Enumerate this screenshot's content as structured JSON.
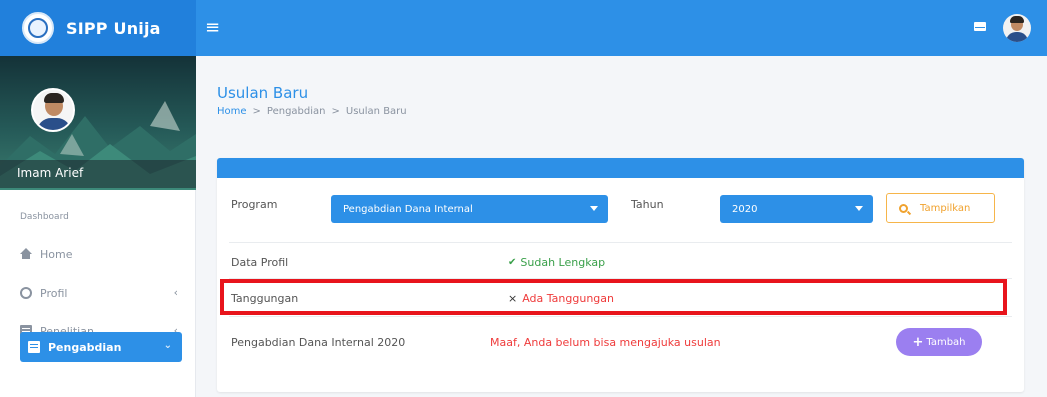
{
  "app": {
    "title": "SIPP Unija"
  },
  "topbar": {
    "menu_icon": "hamburger-icon",
    "mail_icon": "mail-icon",
    "avatar": "user-avatar"
  },
  "sidebar": {
    "user_name": "Imam Arief",
    "section_label": "Dashboard",
    "items": [
      {
        "label": "Home",
        "icon": "home-icon",
        "has_chevron": false,
        "active": false
      },
      {
        "label": "Profil",
        "icon": "user-icon",
        "has_chevron": true,
        "active": false
      },
      {
        "label": "Penelitian",
        "icon": "document-icon",
        "has_chevron": true,
        "active": false
      },
      {
        "label": "Pengabdian",
        "icon": "document-icon",
        "has_chevron": true,
        "active": true
      }
    ],
    "chevron_left": "‹",
    "chevron_down": "⌄"
  },
  "page": {
    "title": "Usulan Baru",
    "breadcrumb": [
      "Home",
      "Pengabdian",
      "Usulan Baru"
    ],
    "breadcrumb_sep": ">"
  },
  "filters": {
    "program_label": "Program",
    "program_value": "Pengabdian Dana Internal",
    "tahun_label": "Tahun",
    "tahun_value": "2020",
    "show_button": "Tampilkan"
  },
  "rows": [
    {
      "label": "Data Profil",
      "value": "Sudah Lengkap",
      "status": "ok",
      "icon": "✔"
    },
    {
      "label": "Tanggungan",
      "value": "Ada Tanggungan",
      "status": "bad",
      "icon": "×"
    },
    {
      "label": "Pengabdian Dana Internal 2020",
      "value": "Maaf, Anda belum bisa mengajuka usulan",
      "status": "bad"
    }
  ],
  "add_button": {
    "label": "Tambah",
    "icon": "+"
  },
  "colors": {
    "primary": "#2d90e7",
    "success": "#3aa04a",
    "danger": "#ef3b3b",
    "warning": "#f0a22e",
    "purple": "#9b7ff0",
    "highlight": "#e8141c"
  }
}
